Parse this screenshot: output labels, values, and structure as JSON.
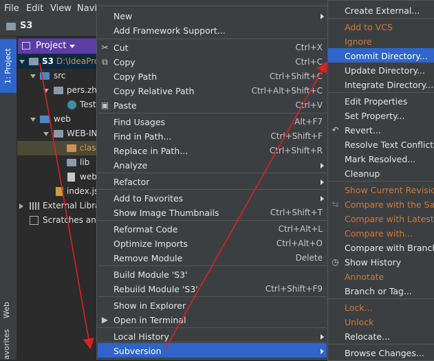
{
  "menubar": {
    "file": "File",
    "edit": "Edit",
    "view": "View",
    "navigate": "Navi"
  },
  "title": {
    "project": "S3"
  },
  "left_strip": {
    "project_tab": "1: Project",
    "web_tab": "Web",
    "favorites_tab": "avorites"
  },
  "project_view": {
    "selector_label": "Project",
    "tree": [
      {
        "label": "S3",
        "path": "D:\\IdeaPro"
      },
      {
        "label": "src"
      },
      {
        "label": "pers.zh"
      },
      {
        "label": "Test"
      },
      {
        "label": "web"
      },
      {
        "label": "WEB-IN"
      },
      {
        "label": "class"
      },
      {
        "label": "lib"
      },
      {
        "label": "web"
      },
      {
        "label": "index.js"
      },
      {
        "label": "External Libra"
      },
      {
        "label": "Scratches and"
      }
    ]
  },
  "context_menu": {
    "items": [
      {
        "label": "New",
        "shortcut": "",
        "submenu": true
      },
      {
        "label": "Add Framework Support...",
        "shortcut": ""
      },
      {
        "label": "Cut",
        "shortcut": "Ctrl+X",
        "icon": "scissors-icon"
      },
      {
        "label": "Copy",
        "shortcut": "Ctrl+C",
        "icon": "copy-icon"
      },
      {
        "label": "Copy Path",
        "shortcut": "Ctrl+Shift+C"
      },
      {
        "label": "Copy Relative Path",
        "shortcut": "Ctrl+Alt+Shift+C"
      },
      {
        "label": "Paste",
        "shortcut": "Ctrl+V",
        "icon": "clipboard-icon"
      },
      {
        "label": "Find Usages",
        "shortcut": "Alt+F7"
      },
      {
        "label": "Find in Path...",
        "shortcut": "Ctrl+Shift+F"
      },
      {
        "label": "Replace in Path...",
        "shortcut": "Ctrl+Shift+R"
      },
      {
        "label": "Analyze",
        "shortcut": "",
        "submenu": true
      },
      {
        "label": "Refactor",
        "shortcut": "",
        "submenu": true
      },
      {
        "label": "Add to Favorites",
        "shortcut": "",
        "submenu": true
      },
      {
        "label": "Show Image Thumbnails",
        "shortcut": "Ctrl+Shift+T"
      },
      {
        "label": "Reformat Code",
        "shortcut": "Ctrl+Alt+L"
      },
      {
        "label": "Optimize Imports",
        "shortcut": "Ctrl+Alt+O"
      },
      {
        "label": "Remove Module",
        "shortcut": "Delete"
      },
      {
        "label": "Build Module 'S3'",
        "shortcut": ""
      },
      {
        "label": "Rebuild Module 'S3'",
        "shortcut": "Ctrl+Shift+F9"
      },
      {
        "label": "Show in Explorer",
        "shortcut": ""
      },
      {
        "label": "Open in Terminal",
        "shortcut": "",
        "icon": "terminal-icon"
      },
      {
        "label": "Local History",
        "shortcut": "",
        "submenu": true
      },
      {
        "label": "Subversion",
        "shortcut": "",
        "submenu": true,
        "highlighted": true
      }
    ]
  },
  "svn_menu": {
    "items": [
      {
        "label": "Create External..."
      },
      {
        "label": "Add to VCS",
        "disabled": true
      },
      {
        "label": "Ignore",
        "disabled": true
      },
      {
        "label": "Commit Directory...",
        "highlighted": true
      },
      {
        "label": "Update Directory..."
      },
      {
        "label": "Integrate Directory..."
      },
      {
        "label": "Edit Properties"
      },
      {
        "label": "Set Property..."
      },
      {
        "label": "Revert...",
        "icon": "revert-icon"
      },
      {
        "label": "Resolve Text Conflict..."
      },
      {
        "label": "Mark Resolved..."
      },
      {
        "label": "Cleanup"
      },
      {
        "label": "Show Current Revision",
        "disabled": true
      },
      {
        "label": "Compare with the Sam",
        "disabled": true,
        "icon": "compare-icon"
      },
      {
        "label": "Compare with Latest R",
        "disabled": true
      },
      {
        "label": "Compare with...",
        "disabled": true
      },
      {
        "label": "Compare with Branch..."
      },
      {
        "label": "Show History",
        "icon": "history-icon"
      },
      {
        "label": "Annotate",
        "disabled": true
      },
      {
        "label": "Branch or Tag..."
      },
      {
        "label": "Lock...",
        "disabled": true
      },
      {
        "label": "Unlock",
        "disabled": true
      },
      {
        "label": "Relocate..."
      },
      {
        "label": "Browse Changes..."
      }
    ]
  },
  "colors": {
    "highlight": "#2f65ca",
    "disabled_orange": "#ce7a3a",
    "menu_bg": "#3c3f41",
    "arrow_red": "#e02020"
  }
}
